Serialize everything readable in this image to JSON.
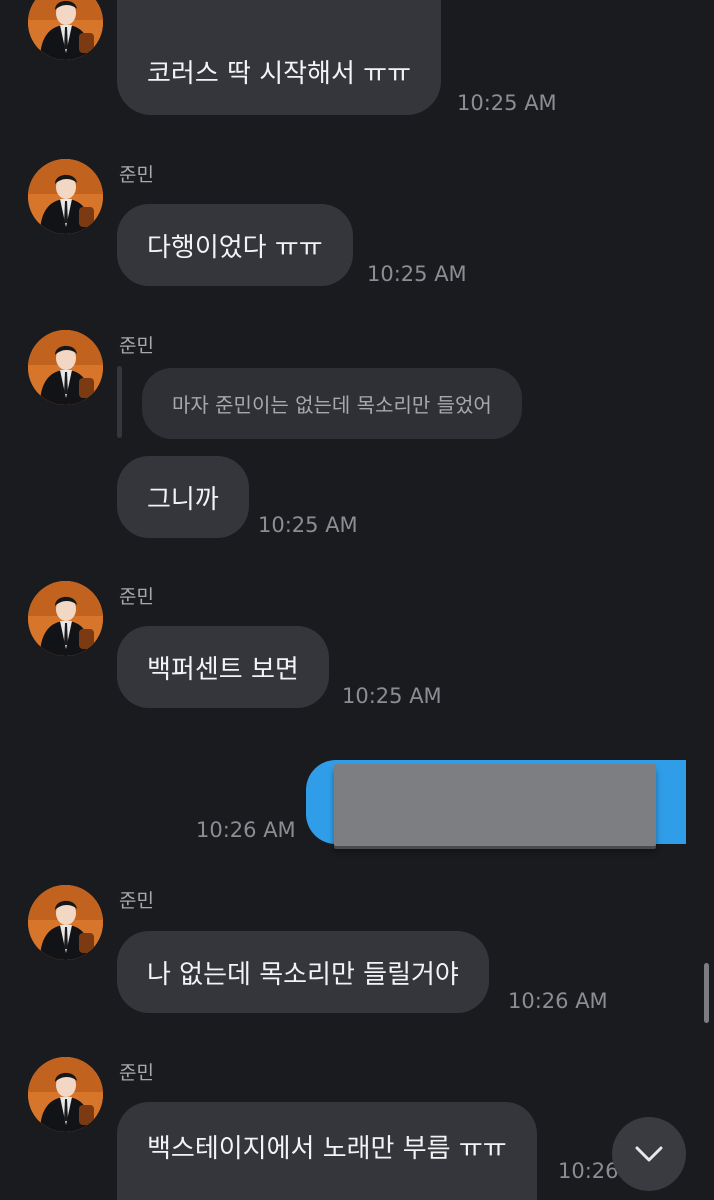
{
  "messages": [
    {
      "sender": "준민",
      "text": "코러스 딱 시작해서 ㅠㅠ",
      "time": "10:25 AM"
    },
    {
      "sender": "준민",
      "text": "다행이었다 ㅠㅠ",
      "time": "10:25 AM"
    },
    {
      "sender": "준민",
      "quote": "마자 준민이는 없는데 목소리만 들었어",
      "text": "그니까",
      "time": "10:25 AM"
    },
    {
      "sender": "준민",
      "text": "백퍼센트 보면",
      "time": "10:25 AM"
    },
    {
      "sender": "me",
      "time": "10:26 AM"
    },
    {
      "sender": "준민",
      "text": "나 없는데 목소리만 들릴거야",
      "time": "10:26 AM"
    },
    {
      "sender": "준민",
      "text": "백스테이지에서 노래만 부름 ㅠㅠ",
      "time": "10:26"
    }
  ],
  "colors": {
    "background": "#1a1b1f",
    "incoming_bubble": "#34363b",
    "outgoing_bubble": "#2f9de8"
  },
  "icons": {
    "scroll_down": "chevron-down-icon"
  }
}
